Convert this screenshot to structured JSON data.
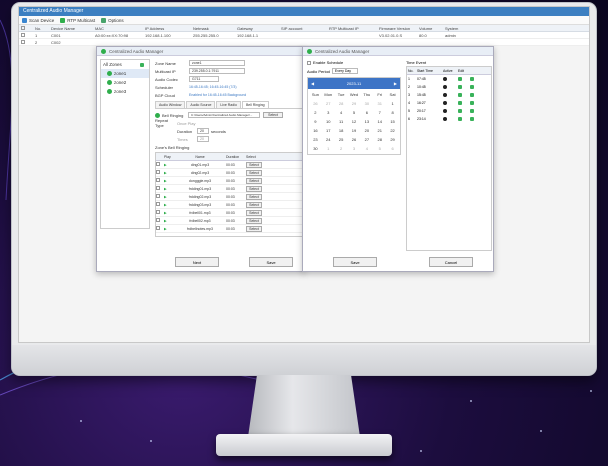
{
  "window": {
    "title": "Centralized Audio Manager"
  },
  "toolbar": {
    "items": [
      "Scan Device",
      "RTP Multicast",
      "Options"
    ]
  },
  "device_table": {
    "headers": [
      "",
      "No.",
      "Device Name",
      "MAC",
      "IP Address",
      "Netmask",
      "Gateway",
      "SIP account",
      "RTP Multicast IP",
      "Firmware Version",
      "Volume",
      "System"
    ],
    "rows": [
      [
        "",
        "1",
        "C001",
        "A0:00:xx:XX:70:98",
        "192.168.1.100",
        "255.255.255.0",
        "192.168.1.1",
        "",
        "",
        "V3.02.01.0.S",
        "80.0",
        "admin"
      ],
      [
        "",
        "2",
        "C002",
        "",
        "",
        "",
        "",
        "",
        "",
        "",
        "",
        ""
      ]
    ]
  },
  "zone_dialog": {
    "title": "Centralized Audio Manager",
    "zone_list": {
      "root": "All Zones",
      "zones": [
        "zone1",
        "zone2",
        "zone3"
      ]
    },
    "fields": [
      {
        "label": "Zone Name",
        "value": "zone1"
      },
      {
        "label": "Multicast IP",
        "value": "239.255.0.1:7911"
      },
      {
        "label": "Audio Codec",
        "value": "G711"
      },
      {
        "label": "Scheduler",
        "value": "16:45-16:45; 16:45-16:45 (7/3)"
      },
      {
        "label": "BGP Cloud",
        "value": "Enabled for 16:45-16:45 Background"
      }
    ],
    "tabs": [
      "Audio Window",
      "Audio Source",
      "Live Radio",
      "Bell Ringing"
    ],
    "bell_option": "Bell Ringing",
    "bell_path": "C:/Users/Admin/Centralized Audio Manager/...",
    "select_label": "Select",
    "repeat_label": "Repeat Type",
    "repeat_options": [
      "Once Play",
      "Duration",
      "Times"
    ],
    "duration_value": "20",
    "duration_unit": "seconds",
    "times_value": "20",
    "list_caption": "Zone's Bell Ringing",
    "file_headers": [
      "",
      "Play",
      "Name",
      "Duration",
      "Select"
    ],
    "files": [
      {
        "name": "ding01.mp3",
        "duration": "00:03"
      },
      {
        "name": "ding02.mp3",
        "duration": "00:03"
      },
      {
        "name": "dongggle.mp3",
        "duration": "00:03"
      },
      {
        "name": "frdding01.mp3",
        "duration": "00:03"
      },
      {
        "name": "frdding02.mp3",
        "duration": "00:03"
      },
      {
        "name": "frdding03.mp3",
        "duration": "00:03"
      },
      {
        "name": "frdbell01.mp3",
        "duration": "00:03"
      },
      {
        "name": "frdbell02.mp3",
        "duration": "00:03"
      },
      {
        "name": "frdbellnotes.mp3",
        "duration": "00:03"
      }
    ],
    "next_label": "Next",
    "save_label": "Save"
  },
  "schedule_dialog": {
    "title": "Centralized Audio Manager",
    "enable_label": "Enable Schedule",
    "mode_label": "Audio Period",
    "mode_value": "Every Day",
    "calendar": {
      "month": "2023-11",
      "weekdays": [
        "Sun",
        "Mon",
        "Tue",
        "Wed",
        "Thu",
        "Fri",
        "Sat"
      ],
      "days": [
        "26",
        "27",
        "28",
        "29",
        "30",
        "31",
        "1",
        "2",
        "3",
        "4",
        "5",
        "6",
        "7",
        "8",
        "9",
        "10",
        "11",
        "12",
        "13",
        "14",
        "15",
        "16",
        "17",
        "18",
        "19",
        "20",
        "21",
        "22",
        "23",
        "24",
        "25",
        "26",
        "27",
        "28",
        "29",
        "30",
        "1",
        "2",
        "3",
        "4",
        "5",
        "6"
      ]
    },
    "time_caption": "Time Event",
    "time_headers": [
      "No.",
      "Start Time",
      "Active",
      "Edit",
      ""
    ],
    "time_rows": [
      {
        "no": "1",
        "time": "07:45"
      },
      {
        "no": "2",
        "time": "10:45"
      },
      {
        "no": "3",
        "time": "15:45"
      },
      {
        "no": "4",
        "time": "16:27"
      },
      {
        "no": "5",
        "time": "20:17"
      },
      {
        "no": "6",
        "time": "23:14"
      }
    ],
    "save_label": "Save",
    "cancel_label": "Cancel"
  }
}
